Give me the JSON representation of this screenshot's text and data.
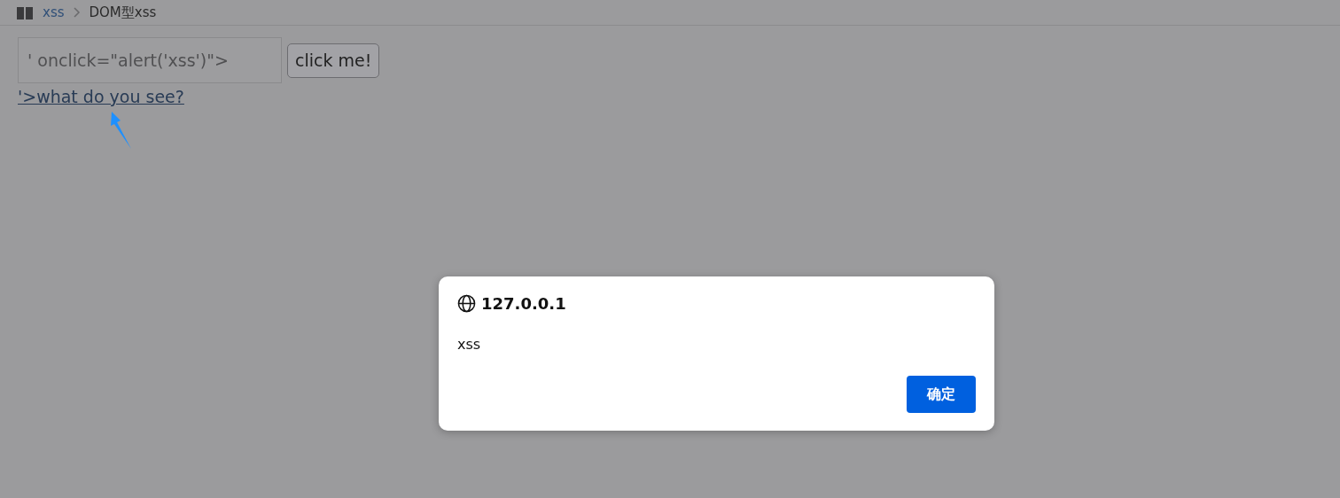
{
  "breadcrumb": [
    {
      "label": "xss",
      "kind": "link"
    },
    {
      "label": "DOM型xss",
      "kind": "current"
    }
  ],
  "form": {
    "input": {
      "value": "' onclick=\"alert('xss')\">"
    },
    "button": "click me!",
    "link": "'>what do you see?"
  },
  "dialog": {
    "title": "127.0.0.1",
    "message": "xss",
    "buttons": [
      "确定"
    ]
  }
}
